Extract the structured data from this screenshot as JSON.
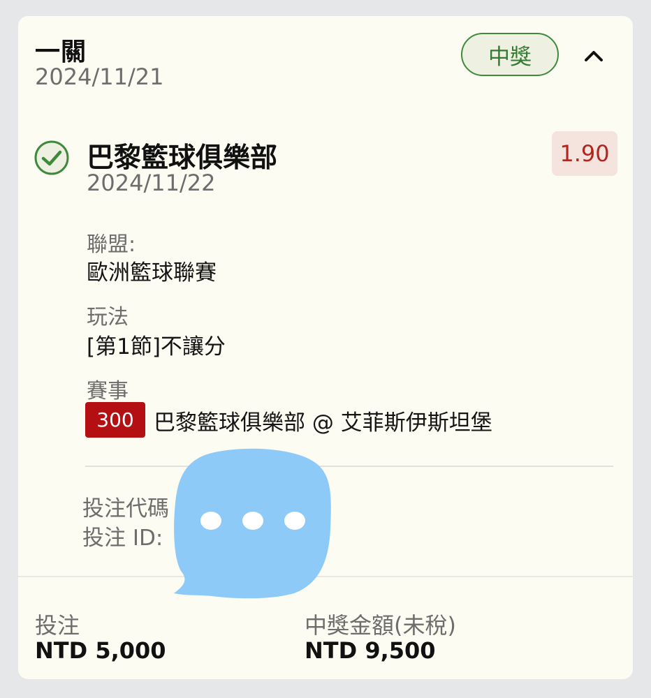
{
  "bet": {
    "type": "一關",
    "date": "2024/11/21",
    "status": "中獎"
  },
  "selection": {
    "team": "巴黎籃球俱樂部",
    "date": "2024/11/22",
    "odds": "1.90",
    "league_label": "聯盟:",
    "league_value": "歐洲籃球聯賽",
    "market_label": "玩法",
    "market_value": "[第1節]不讓分",
    "event_label": "賽事",
    "event_code": "300",
    "event_name": "巴黎籃球俱樂部 @ 艾菲斯伊斯坦堡"
  },
  "reference": {
    "code_label": "投注代碼",
    "id_label": "投注 ID:"
  },
  "summary": {
    "stake_label": "投注",
    "stake_value": "NTD 5,000",
    "payout_label": "中獎金額(未稅)",
    "payout_value": "NTD 9,500"
  },
  "colors": {
    "win_green": "#3e8a3a",
    "odds_red": "#b3261e",
    "event_code_red": "#b40f13",
    "card_background": "#fdfcf3",
    "overlay_blue": "#8ecaf7"
  },
  "icons": {
    "collapse": "chevron-up-icon",
    "selection_status": "check-circle-icon",
    "overlay": "chat-bubble-icon"
  }
}
